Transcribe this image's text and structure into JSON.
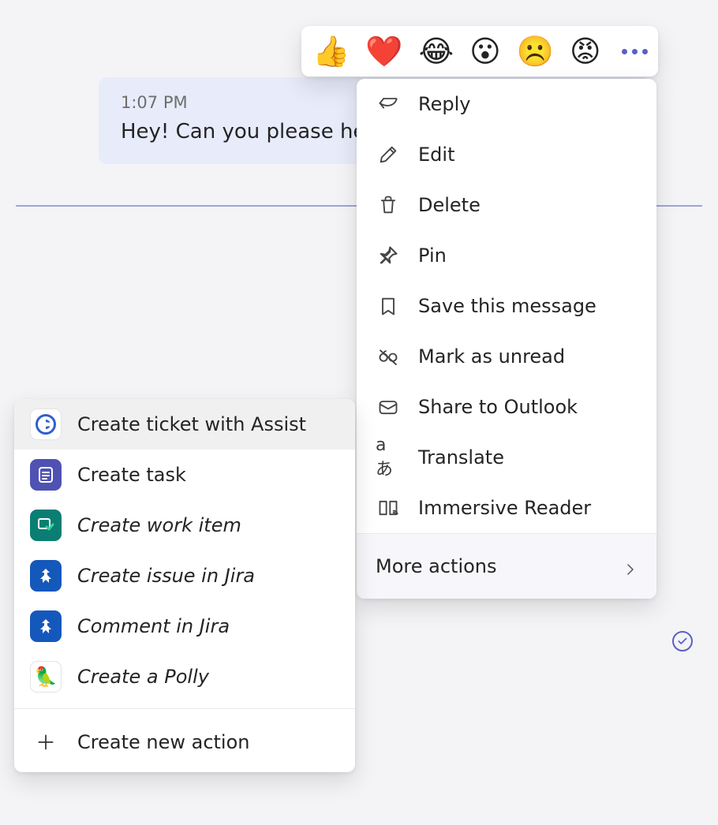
{
  "message": {
    "time": "1:07 PM",
    "body": "Hey! Can you please he"
  },
  "reactions": {
    "emojis": [
      "👍",
      "❤️",
      "😂",
      "😮",
      "☹️",
      "😡"
    ]
  },
  "context_menu": {
    "items": [
      {
        "icon": "reply-icon",
        "label": "Reply"
      },
      {
        "icon": "edit-icon",
        "label": "Edit"
      },
      {
        "icon": "delete-icon",
        "label": "Delete"
      },
      {
        "icon": "pin-icon",
        "label": "Pin"
      },
      {
        "icon": "bookmark-icon",
        "label": "Save this message"
      },
      {
        "icon": "mark-unread-icon",
        "label": "Mark as unread"
      },
      {
        "icon": "share-outlook-icon",
        "label": "Share to Outlook"
      },
      {
        "icon": "translate-icon",
        "label": "Translate"
      },
      {
        "icon": "immersive-reader-icon",
        "label": "Immersive Reader"
      }
    ],
    "more_actions_label": "More actions"
  },
  "submenu": {
    "items": [
      {
        "tile": "assist",
        "label": "Create ticket with Assist",
        "italic": false,
        "hovered": true
      },
      {
        "tile": "task",
        "label": "Create task",
        "italic": false,
        "hovered": false
      },
      {
        "tile": "work",
        "label": "Create work item",
        "italic": true,
        "hovered": false
      },
      {
        "tile": "jira",
        "label": "Create issue in Jira",
        "italic": true,
        "hovered": false
      },
      {
        "tile": "jira",
        "label": "Comment in Jira",
        "italic": true,
        "hovered": false
      },
      {
        "tile": "polly",
        "label": "Create a Polly",
        "italic": true,
        "hovered": false
      }
    ],
    "create_new_label": "Create new action"
  }
}
